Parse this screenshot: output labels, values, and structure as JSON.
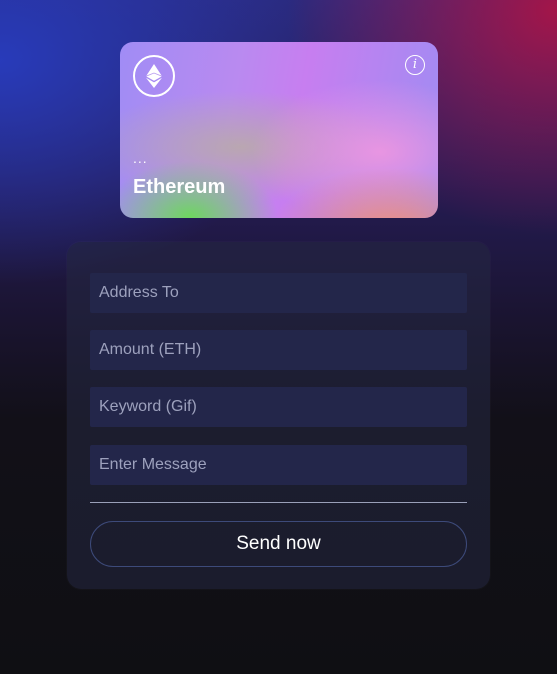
{
  "card": {
    "address": "...",
    "network": "Ethereum",
    "logo_icon": "ethereum-logo-icon",
    "info_icon": "info-icon"
  },
  "form": {
    "address_placeholder": "Address To",
    "amount_placeholder": "Amount (ETH)",
    "keyword_placeholder": "Keyword (Gif)",
    "message_placeholder": "Enter Message",
    "send_label": "Send now"
  },
  "colors": {
    "field_bg": "#23264a",
    "button_border": "#3d4a7a",
    "text": "#ffffff"
  }
}
